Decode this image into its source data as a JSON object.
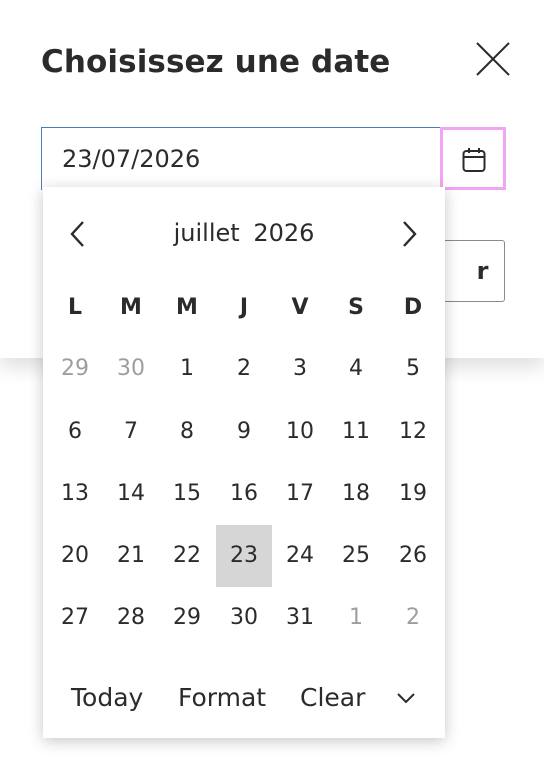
{
  "dialog": {
    "title": "Choisissez une date",
    "close_icon": "close-icon"
  },
  "date_field": {
    "value": "23/07/2026",
    "toggle_icon": "calendar-icon"
  },
  "behind_button": {
    "label_fragment": "r"
  },
  "calendar": {
    "month": "juillet",
    "year": "2026",
    "prev_icon": "chevron-left-icon",
    "next_icon": "chevron-right-icon",
    "weekdays": [
      "L",
      "M",
      "M",
      "J",
      "V",
      "S",
      "D"
    ],
    "weeks": [
      [
        {
          "d": "29",
          "other": true
        },
        {
          "d": "30",
          "other": true
        },
        {
          "d": "1"
        },
        {
          "d": "2"
        },
        {
          "d": "3"
        },
        {
          "d": "4"
        },
        {
          "d": "5"
        }
      ],
      [
        {
          "d": "6"
        },
        {
          "d": "7"
        },
        {
          "d": "8"
        },
        {
          "d": "9"
        },
        {
          "d": "10"
        },
        {
          "d": "11"
        },
        {
          "d": "12"
        }
      ],
      [
        {
          "d": "13"
        },
        {
          "d": "14"
        },
        {
          "d": "15"
        },
        {
          "d": "16"
        },
        {
          "d": "17"
        },
        {
          "d": "18"
        },
        {
          "d": "19"
        }
      ],
      [
        {
          "d": "20"
        },
        {
          "d": "21"
        },
        {
          "d": "22"
        },
        {
          "d": "23",
          "selected": true
        },
        {
          "d": "24"
        },
        {
          "d": "25"
        },
        {
          "d": "26"
        }
      ],
      [
        {
          "d": "27"
        },
        {
          "d": "28"
        },
        {
          "d": "29"
        },
        {
          "d": "30"
        },
        {
          "d": "31"
        },
        {
          "d": "1",
          "other": true
        },
        {
          "d": "2",
          "other": true
        }
      ]
    ],
    "footer": {
      "today": "Today",
      "format": "Format",
      "clear": "Clear",
      "more_icon": "chevron-down-icon"
    }
  },
  "colors": {
    "toggle_focus_border": "#f2a5f2",
    "input_border": "#4a7fb5",
    "selected_day_bg": "#d6d6d6",
    "other_month_text": "#9e9e9e"
  }
}
